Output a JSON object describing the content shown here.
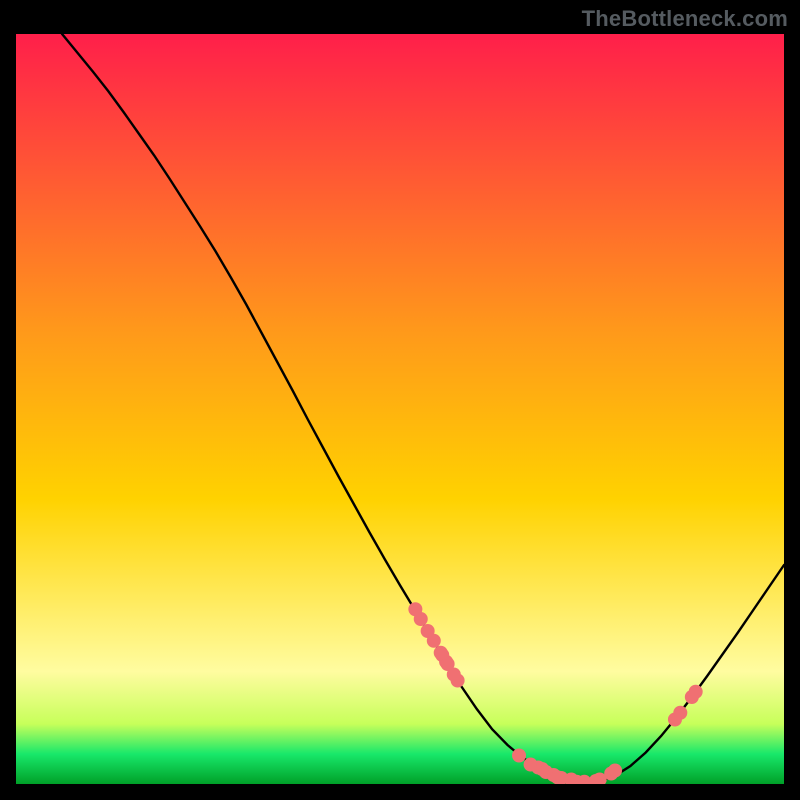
{
  "watermark": "TheBottleneck.com",
  "colors": {
    "gradient_top": "#ff1f4a",
    "gradient_mid": "#ffd200",
    "gradient_lowlight": "#fffca0",
    "gradient_green_top": "#c7ff5a",
    "gradient_green": "#18e86a",
    "gradient_green_deep": "#00a028",
    "curve": "#000000",
    "marker": "#f07072",
    "frame_bg": "#000000"
  },
  "chart_data": {
    "type": "line",
    "title": "",
    "xlabel": "",
    "ylabel": "",
    "xlim": [
      0,
      100
    ],
    "ylim": [
      0,
      100
    ],
    "curve": {
      "name": "bottleneck-curve",
      "x": [
        6,
        8,
        10,
        12,
        14,
        16,
        18,
        20,
        22,
        24,
        26,
        28,
        30,
        32,
        34,
        36,
        38,
        40,
        42,
        44,
        46,
        48,
        50,
        52,
        54,
        56,
        58,
        60,
        62,
        64,
        66,
        68,
        70,
        72,
        74,
        76,
        78,
        80,
        82,
        84,
        86,
        88,
        90,
        92,
        94,
        96,
        98,
        100
      ],
      "y": [
        100,
        97.5,
        95,
        92.4,
        89.6,
        86.7,
        83.8,
        80.7,
        77.5,
        74.3,
        71,
        67.5,
        63.9,
        60.1,
        56.3,
        52.5,
        48.6,
        44.8,
        41,
        37.3,
        33.6,
        30,
        26.5,
        23.1,
        19.7,
        16.3,
        13,
        10,
        7.3,
        5.2,
        3.5,
        2.2,
        1.2,
        0.6,
        0.3,
        0.4,
        1.1,
        2.4,
        4.2,
        6.4,
        8.9,
        11.6,
        14.4,
        17.3,
        20.2,
        23.2,
        26.2,
        29.2
      ]
    },
    "series": [
      {
        "name": "cluster-left",
        "x": [
          52.0,
          52.7,
          53.6,
          54.4,
          55.3,
          55.5,
          56.0,
          56.2,
          57.0,
          57.5
        ],
        "y": [
          23.3,
          22.0,
          20.4,
          19.1,
          17.5,
          17.2,
          16.3,
          16.0,
          14.6,
          13.8
        ]
      },
      {
        "name": "cluster-bottom",
        "x": [
          65.5,
          67.0,
          68.0,
          68.5,
          69.0,
          70.0,
          70.5,
          71.0,
          72.3,
          73.0,
          74.0,
          75.5,
          76.0,
          77.5,
          78.0
        ],
        "y": [
          3.8,
          2.6,
          2.2,
          2.0,
          1.6,
          1.2,
          0.9,
          0.8,
          0.6,
          0.3,
          0.3,
          0.4,
          0.6,
          1.4,
          1.8
        ]
      },
      {
        "name": "cluster-right",
        "x": [
          85.8,
          86.5,
          88.0,
          88.5
        ],
        "y": [
          8.6,
          9.5,
          11.6,
          12.3
        ]
      }
    ]
  }
}
